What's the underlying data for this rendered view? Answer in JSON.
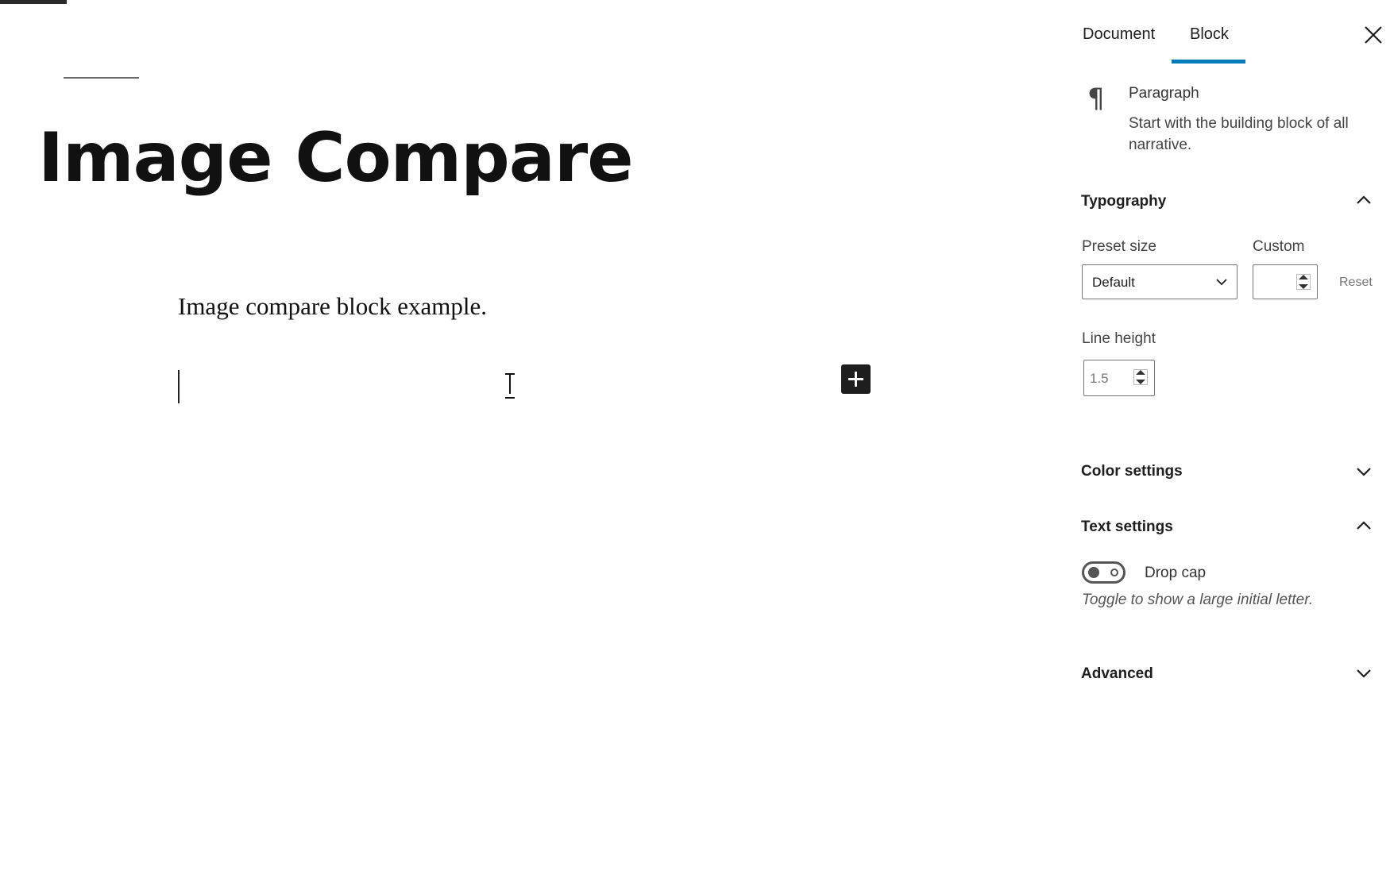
{
  "editor": {
    "post_title": "Image Compare",
    "paragraph_text": "Image compare block example."
  },
  "sidebar": {
    "tabs": [
      {
        "label": "Document",
        "active": false
      },
      {
        "label": "Block",
        "active": true
      }
    ],
    "accent_color": "#007cba",
    "block_card": {
      "icon": "paragraph-icon",
      "icon_glyph": "¶",
      "name": "Paragraph",
      "description": "Start with the building block of all narrative."
    },
    "typography": {
      "title": "Typography",
      "expanded": true,
      "preset_size_label": "Preset size",
      "preset_size_value": "Default",
      "custom_label": "Custom",
      "custom_value": "",
      "reset_label": "Reset",
      "line_height_label": "Line height",
      "line_height_value": "1.5"
    },
    "color_settings": {
      "title": "Color settings",
      "expanded": false
    },
    "text_settings": {
      "title": "Text settings",
      "expanded": true,
      "drop_cap_label": "Drop cap",
      "drop_cap_enabled": false,
      "drop_cap_help": "Toggle to show a large initial letter."
    },
    "advanced": {
      "title": "Advanced",
      "expanded": false
    }
  }
}
